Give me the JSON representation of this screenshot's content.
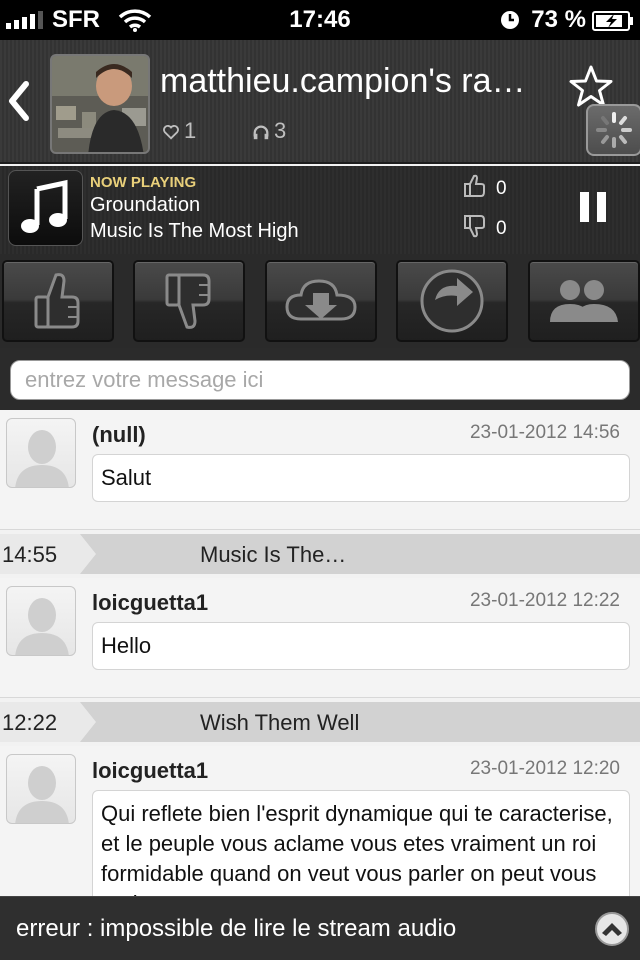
{
  "status_bar": {
    "carrier": "SFR",
    "time": "17:46",
    "battery_pct": "73 %"
  },
  "header": {
    "radio_title": "matthieu.campion's ra…",
    "likes": "1",
    "listeners": "3"
  },
  "now_playing": {
    "label": "NOW PLAYING",
    "artist": "Groundation",
    "track": "Music Is The Most High",
    "votes_up": "0",
    "votes_down": "0"
  },
  "composer": {
    "placeholder": "entrez votre message ici"
  },
  "feed": {
    "messages": [
      {
        "user": "(null)",
        "date": "23-01-2012 14:56",
        "text": "Salut"
      },
      {
        "user": "loicguetta1",
        "date": "23-01-2012 12:22",
        "text": "Hello"
      },
      {
        "user": "loicguetta1",
        "date": "23-01-2012 12:20",
        "text": "Qui reflete bien l'esprit dynamique qui te caracterise, et le peuple vous aclame vous etes vraiment un roi formidable quand on veut vous parler on peut vous parler"
      }
    ],
    "separators": [
      {
        "time": "14:55",
        "title": "Music Is The…"
      },
      {
        "time": "12:22",
        "title": "Wish Them Well"
      }
    ]
  },
  "error_bar": {
    "text": "erreur : impossible de lire le stream audio"
  },
  "icons": {
    "back": "chevron-left-icon",
    "favorite": "star-icon",
    "loading": "spinner-icon",
    "like": "heart-icon",
    "listeners": "headphones-icon",
    "music": "music-note-icon",
    "thumb_up": "thumbs-up-icon",
    "thumb_down": "thumbs-down-icon",
    "download": "cloud-download-icon",
    "share": "share-arrow-icon",
    "users": "users-icon",
    "pause": "pause-icon",
    "expand": "chevron-up-icon"
  },
  "colors": {
    "now_playing_label": "#e8cf7a",
    "header_bg": "#343434",
    "feed_bg": "#f2f2f2"
  }
}
